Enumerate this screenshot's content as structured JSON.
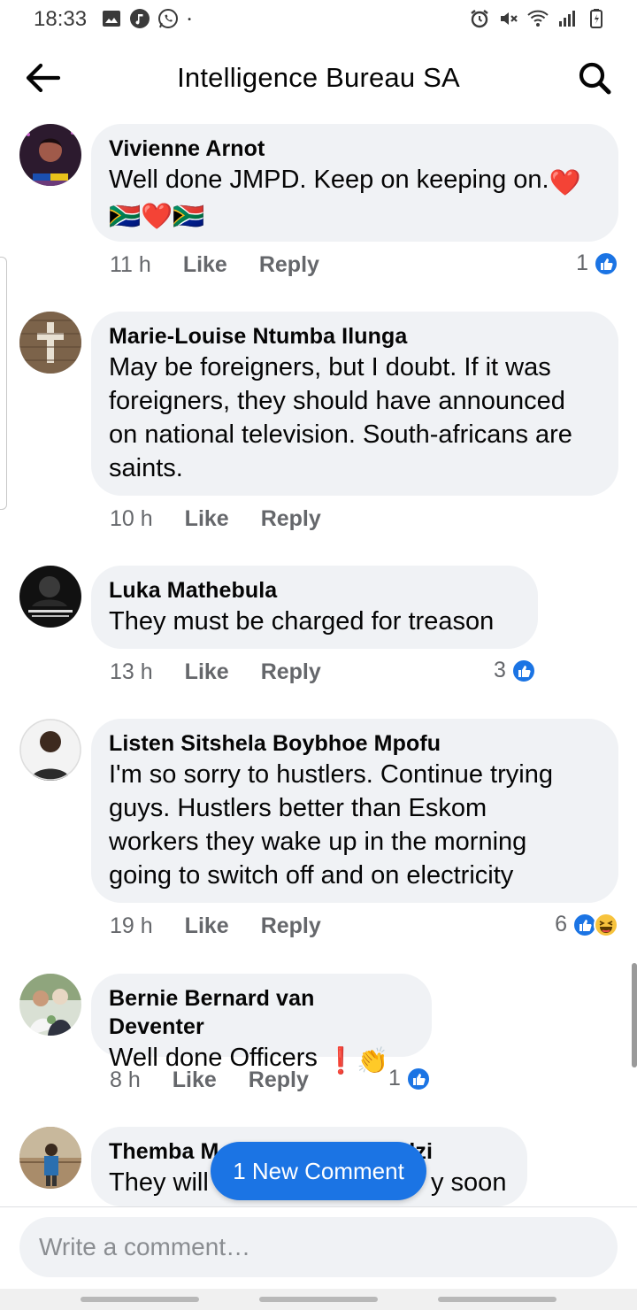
{
  "status_bar": {
    "time": "18:33",
    "left_icons": [
      "gallery-icon",
      "music-icon",
      "whatsapp-icon",
      "dot-icon"
    ],
    "right_icons": [
      "alarm-icon",
      "mute-icon",
      "wifi-icon",
      "signal-icon",
      "battery-icon"
    ]
  },
  "header": {
    "title": "Intelligence Bureau SA",
    "back_icon": "back-arrow-icon",
    "search_icon": "search-icon"
  },
  "comments": [
    {
      "author": "Vivienne Arnot",
      "text_lines": [
        "Well done JMPD. Keep on keeping on.",
        ""
      ],
      "emoji_line1_suffix": "❤️",
      "emoji_line2": "🇿🇦❤️🇿🇦",
      "time": "11 h",
      "like_label": "Like",
      "reply_label": "Reply",
      "reaction_count": "1",
      "reactions": [
        "like"
      ]
    },
    {
      "author": "Marie-Louise Ntumba Ilunga",
      "text_lines": [
        "May be foreigners, but I doubt. If it was",
        "foreigners, they should have announced",
        "on national television. South-africans are",
        "saints."
      ],
      "time": "10 h",
      "like_label": "Like",
      "reply_label": "Reply",
      "reaction_count": "",
      "reactions": []
    },
    {
      "author": "Luka Mathebula",
      "text_lines": [
        "They must be charged for treason"
      ],
      "time": "13 h",
      "like_label": "Like",
      "reply_label": "Reply",
      "reaction_count": "3",
      "reactions": [
        "like"
      ]
    },
    {
      "author": "Listen Sitshela Boybhoe Mpofu",
      "text_lines": [
        "I'm so sorry to hustlers. Continue trying",
        "guys. Hustlers better than Eskom",
        "workers they wake up in the morning",
        "going to switch off and on electricity"
      ],
      "time": "19 h",
      "like_label": "Like",
      "reply_label": "Reply",
      "reaction_count": "6",
      "reactions": [
        "like",
        "haha"
      ]
    },
    {
      "author": "Bernie Bernard van Deventer",
      "text_lines": [
        "Well done Officers"
      ],
      "emoji_line1_suffix": "❗👏",
      "time": "8 h",
      "like_label": "Like",
      "reply_label": "Reply",
      "reaction_count": "1",
      "reactions": [
        "like"
      ]
    },
    {
      "author": "Themba M",
      "author_tail": "dzi",
      "text_head": "They will",
      "text_tail": "y soon"
    }
  ],
  "new_comment_pill": "1 New Comment",
  "composer": {
    "placeholder": "Write a comment…"
  },
  "colors": {
    "bubble": "#f0f2f5",
    "meta": "#65676b",
    "accent": "#1b74e4"
  }
}
